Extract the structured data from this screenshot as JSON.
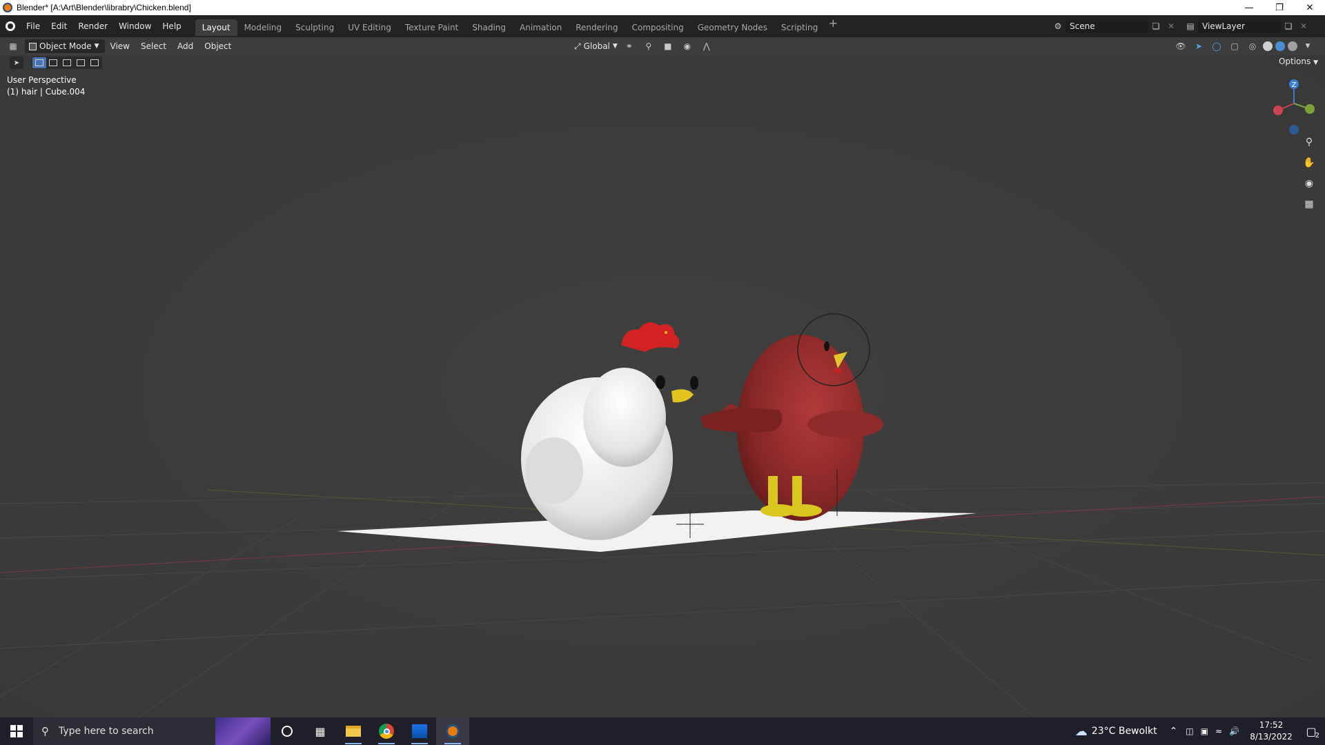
{
  "window": {
    "title": "Blender* [A:\\Art\\Blender\\librabry\\Chicken.blend]"
  },
  "menu": {
    "file": "File",
    "edit": "Edit",
    "render": "Render",
    "window": "Window",
    "help": "Help"
  },
  "workspaces": [
    {
      "label": "Layout",
      "active": true
    },
    {
      "label": "Modeling"
    },
    {
      "label": "Sculpting"
    },
    {
      "label": "UV Editing"
    },
    {
      "label": "Texture Paint"
    },
    {
      "label": "Shading"
    },
    {
      "label": "Animation"
    },
    {
      "label": "Rendering"
    },
    {
      "label": "Compositing"
    },
    {
      "label": "Geometry Nodes"
    },
    {
      "label": "Scripting"
    }
  ],
  "scene": {
    "scene_name": "Scene",
    "view_layer": "ViewLayer"
  },
  "viewport_header": {
    "mode": "Object Mode",
    "view": "View",
    "select": "Select",
    "add": "Add",
    "object": "Object",
    "orientation": "Global",
    "options": "Options"
  },
  "viewport": {
    "perspective": "User Perspective",
    "active_object": "(1) hair | Cube.004",
    "gizmo_z": "Z",
    "gizmo_y": "Y"
  },
  "taskbar": {
    "search_placeholder": "Type here to search",
    "weather": "23°C  Bewolkt",
    "time": "17:52",
    "date": "8/13/2022",
    "notifications": "2"
  },
  "colors": {
    "accent": "#4772b3",
    "blender_orange": "#e87d0d",
    "axis_x": "#c8454f",
    "axis_y": "#7ca33b",
    "axis_z": "#3a7fd0"
  }
}
